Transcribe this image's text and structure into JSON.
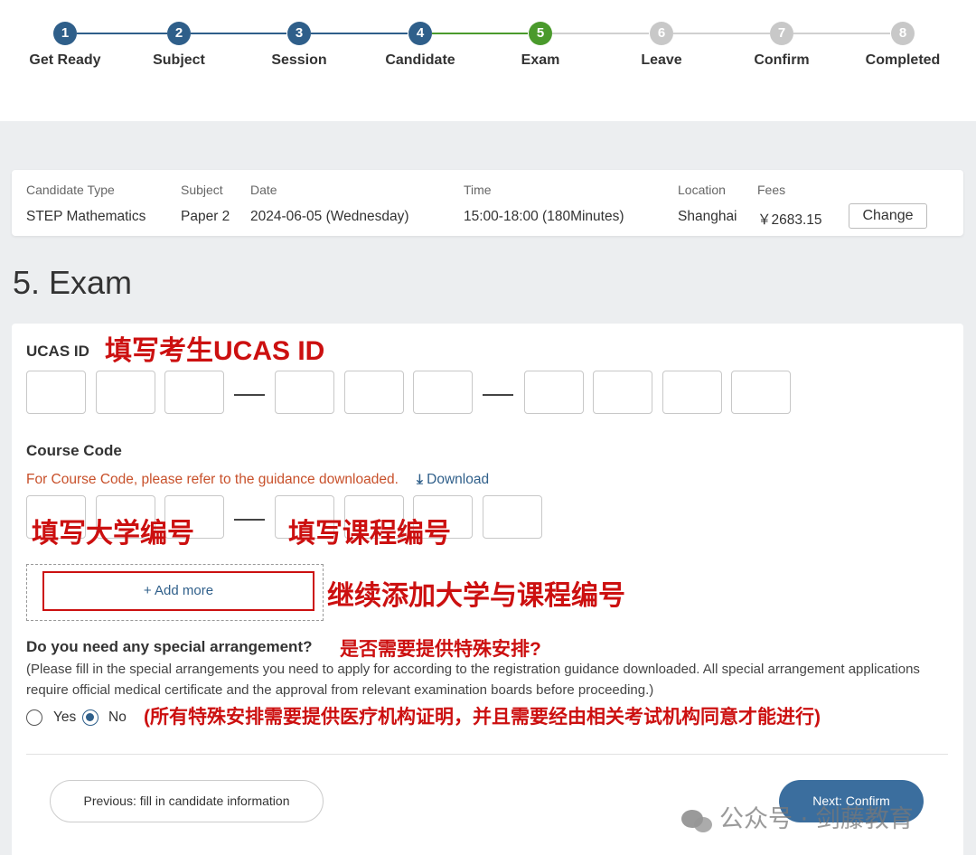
{
  "stepper": {
    "steps": [
      {
        "num": "1",
        "label": "Get Ready",
        "state": "done"
      },
      {
        "num": "2",
        "label": "Subject",
        "state": "done"
      },
      {
        "num": "3",
        "label": "Session",
        "state": "done"
      },
      {
        "num": "4",
        "label": "Candidate",
        "state": "done"
      },
      {
        "num": "5",
        "label": "Exam",
        "state": "active"
      },
      {
        "num": "6",
        "label": "Leave",
        "state": "todo"
      },
      {
        "num": "7",
        "label": "Confirm",
        "state": "todo"
      },
      {
        "num": "8",
        "label": "Completed",
        "state": "todo"
      }
    ]
  },
  "summary": {
    "candidate_type_label": "Candidate Type",
    "candidate_type_value": "STEP Mathematics",
    "subject_label": "Subject",
    "subject_value": "Paper 2",
    "date_label": "Date",
    "date_value": "2024-06-05 (Wednesday)",
    "time_label": "Time",
    "time_value": "15:00-18:00 (180Minutes)",
    "location_label": "Location",
    "location_value": "Shanghai",
    "fees_label": "Fees",
    "fees_value": "￥2683.15",
    "change_label": "Change"
  },
  "page_title": "5. Exam",
  "ucas": {
    "label": "UCAS ID",
    "annotation": "填写考生UCAS ID"
  },
  "course_code": {
    "label": "Course Code",
    "hint": "For Course Code, please refer to the guidance downloaded.",
    "download_label": "Download",
    "annotation_university": "填写大学编号",
    "annotation_course": "填写课程编号",
    "add_more_label": "+ Add more",
    "annotation_add_more": "继续添加大学与课程编号"
  },
  "special": {
    "question": "Do you need any special arrangement?",
    "annotation_question": "是否需要提供特殊安排?",
    "paragraph": "(Please fill in the special arrangements you need to apply for according to the registration guidance downloaded. All special arrangement applications require official medical certificate and the approval from relevant examination boards before proceeding.)",
    "yes_label": "Yes",
    "no_label": "No",
    "selected": "No",
    "annotation_note": "(所有特殊安排需要提供医疗机构证明，并且需要经由相关考试机构同意才能进行)"
  },
  "nav": {
    "previous_label": "Previous: fill in candidate information",
    "next_label": "Next: Confirm"
  },
  "watermark": "公众号 · 剑藤教育",
  "colors": {
    "done": "#2f5f8a",
    "active": "#4a9a2c",
    "todo": "#c8c8c8",
    "annotation": "#cc1010"
  }
}
